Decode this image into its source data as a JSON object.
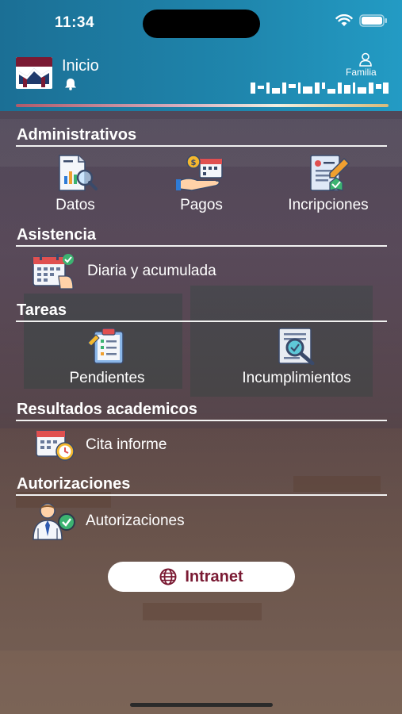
{
  "status_bar": {
    "time": "11:34"
  },
  "header": {
    "title": "Inicio",
    "user_label": "Familia"
  },
  "sections": {
    "administrativos": {
      "title": "Administrativos",
      "items": [
        {
          "label": "Datos",
          "icon": "document-chart-icon"
        },
        {
          "label": "Pagos",
          "icon": "payment-icon"
        },
        {
          "label": "Incripciones",
          "icon": "registration-form-icon"
        }
      ]
    },
    "asistencia": {
      "title": "Asistencia",
      "items": [
        {
          "label": "Diaria y acumulada",
          "icon": "calendar-check-icon"
        }
      ]
    },
    "tareas": {
      "title": "Tareas",
      "items": [
        {
          "label": "Pendientes",
          "icon": "clipboard-icon"
        },
        {
          "label": "Incumplimientos",
          "icon": "document-search-icon"
        }
      ]
    },
    "resultados": {
      "title": "Resultados academicos",
      "items": [
        {
          "label": "Cita informe",
          "icon": "calendar-clock-icon"
        }
      ]
    },
    "autorizaciones": {
      "title": "Autorizaciones",
      "items": [
        {
          "label": "Autorizaciones",
          "icon": "person-check-icon"
        }
      ]
    }
  },
  "intranet_button": {
    "label": "Intranet",
    "icon": "globe-icon"
  },
  "colors": {
    "header": "#1f86ad",
    "brand": "#7a1a33",
    "line": "#f2f2f2"
  }
}
